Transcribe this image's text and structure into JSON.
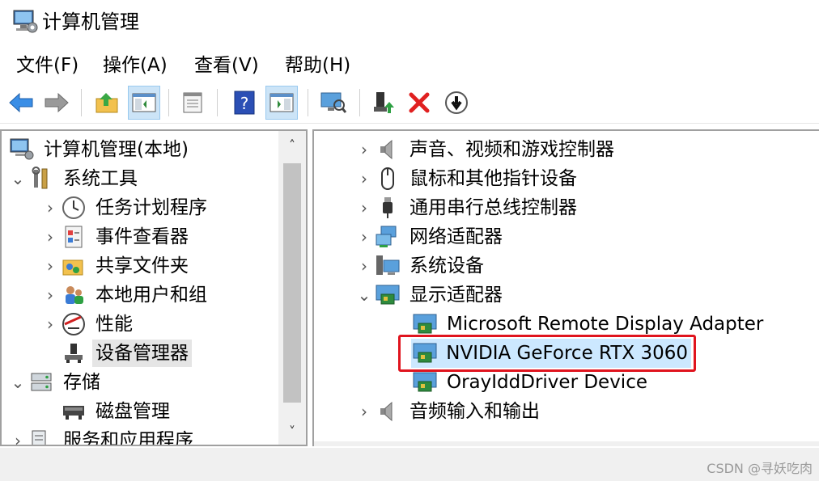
{
  "window": {
    "title": "计算机管理"
  },
  "menu": [
    "文件(F)",
    "操作(A)",
    "查看(V)",
    "帮助(H)"
  ],
  "toolbar": {
    "buttons": [
      "back-arrow-icon",
      "forward-arrow-icon",
      "up-folder-icon",
      "show-hide-tree-icon",
      "properties-icon",
      "help-icon",
      "show-action-pane-icon",
      "scan-hardware-icon",
      "update-driver-icon",
      "uninstall-icon",
      "disable-device-icon"
    ]
  },
  "tree": {
    "root": "计算机管理(本地)",
    "system_tools": "系统工具",
    "task_scheduler": "任务计划程序",
    "event_viewer": "事件查看器",
    "shared_folders": "共享文件夹",
    "local_users": "本地用户和组",
    "performance": "性能",
    "device_manager": "设备管理器",
    "storage": "存储",
    "disk_management": "磁盘管理",
    "services_apps": "服务和应用程序"
  },
  "devices": {
    "sound": "声音、视频和游戏控制器",
    "mice": "鼠标和其他指针设备",
    "usb": "通用串行总线控制器",
    "network": "网络适配器",
    "system": "系统设备",
    "display": "显示适配器",
    "display_children": [
      "Microsoft Remote Display Adapter",
      "NVIDIA GeForce RTX 3060",
      "OrayIddDriver Device"
    ],
    "audio_io": "音频输入和输出"
  },
  "status": {
    "watermark": "CSDN @寻妖吃肉"
  },
  "colors": {
    "highlight": "#cce8ff",
    "annotation": "#e0141e",
    "selection": "#e5e5e5"
  }
}
